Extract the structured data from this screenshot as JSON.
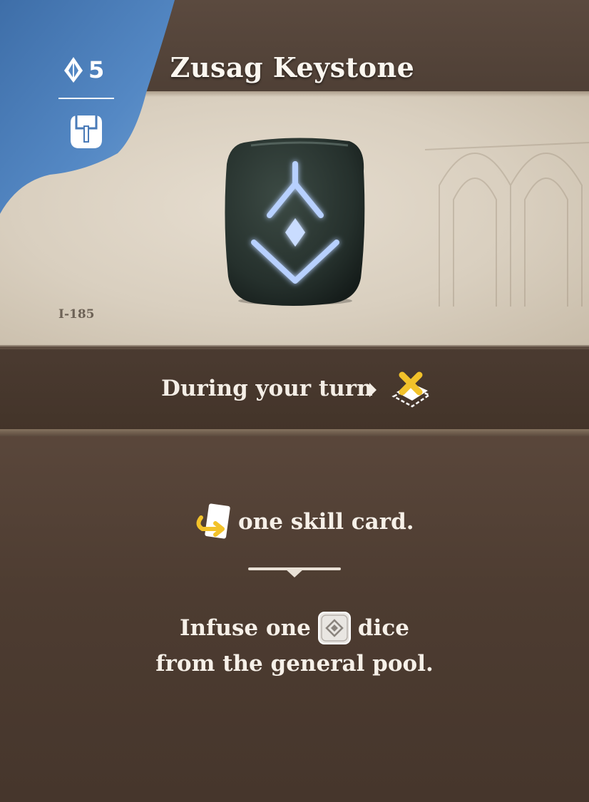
{
  "card": {
    "title": "Zusag Keystone",
    "cost": "5",
    "code": "I-185",
    "trigger": "During your turn",
    "effect_line1_suffix": "one skill card.",
    "effect_line2_prefix": "Infuse one",
    "effect_line2_suffix": "dice",
    "effect_line3": "from the general pool."
  },
  "icons": {
    "cost": "crystal-shard-icon",
    "type": "satchel-icon",
    "trigger": "exhaust-card-icon",
    "skill": "swap-card-icon",
    "die": "dice-icon"
  },
  "colors": {
    "corner_blue": "#4a7bb8",
    "accent_yellow": "#f2c22a",
    "rune_glow": "#a9c6ff"
  }
}
